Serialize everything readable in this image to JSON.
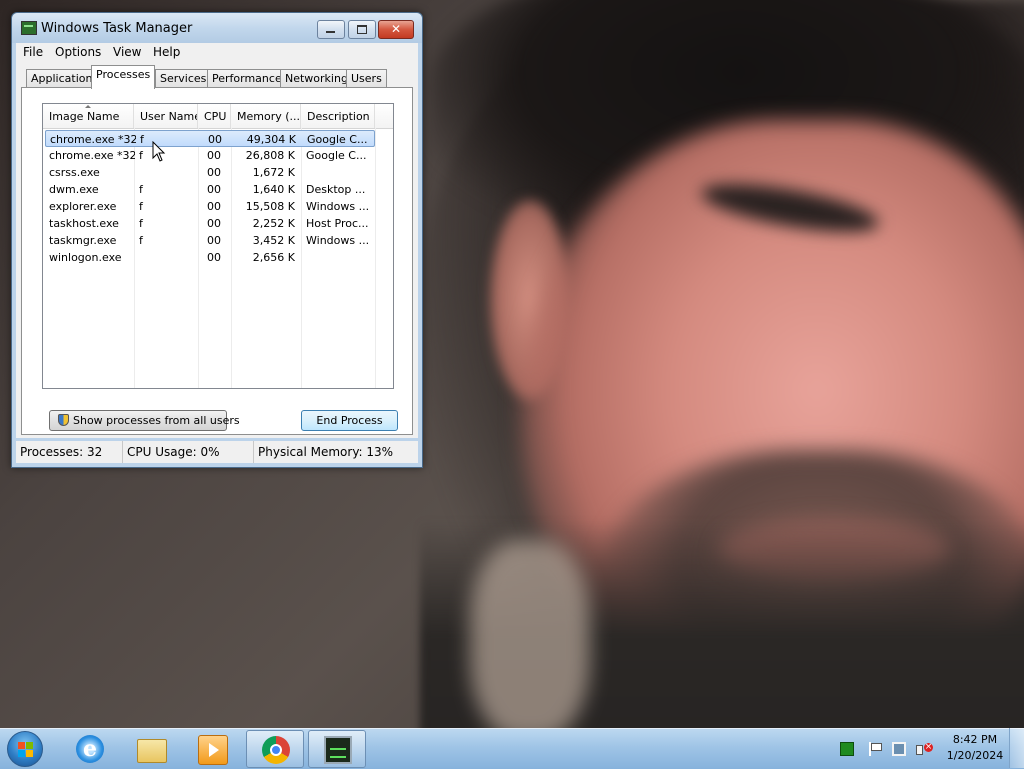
{
  "window": {
    "title": "Windows Task Manager",
    "close_glyph": "✕"
  },
  "menu": [
    "File",
    "Options",
    "View",
    "Help"
  ],
  "tabs": [
    "Applications",
    "Processes",
    "Services",
    "Performance",
    "Networking",
    "Users"
  ],
  "active_tab": "Processes",
  "columns": [
    "Image Name",
    "User Name",
    "CPU",
    "Memory (...",
    "Description"
  ],
  "processes": [
    {
      "name": "chrome.exe *32",
      "user": "f",
      "cpu": "00",
      "memory": "49,304 K",
      "description": "Google C...",
      "selected": true
    },
    {
      "name": "chrome.exe *32",
      "user": "f",
      "cpu": "00",
      "memory": "26,808 K",
      "description": "Google C..."
    },
    {
      "name": "csrss.exe",
      "user": "",
      "cpu": "00",
      "memory": "1,672 K",
      "description": ""
    },
    {
      "name": "dwm.exe",
      "user": "f",
      "cpu": "00",
      "memory": "1,640 K",
      "description": "Desktop ..."
    },
    {
      "name": "explorer.exe",
      "user": "f",
      "cpu": "00",
      "memory": "15,508 K",
      "description": "Windows ..."
    },
    {
      "name": "taskhost.exe",
      "user": "f",
      "cpu": "00",
      "memory": "2,252 K",
      "description": "Host Proc..."
    },
    {
      "name": "taskmgr.exe",
      "user": "f",
      "cpu": "00",
      "memory": "3,452 K",
      "description": "Windows ..."
    },
    {
      "name": "winlogon.exe",
      "user": "",
      "cpu": "00",
      "memory": "2,656 K",
      "description": ""
    }
  ],
  "buttons": {
    "show_all": "Show processes from all users",
    "end_process": "End Process"
  },
  "status": {
    "processes": "Processes: 32",
    "cpu": "CPU Usage: 0%",
    "memory": "Physical Memory: 13%"
  },
  "taskbar": {
    "pinned": [
      "internet-explorer",
      "windows-explorer",
      "media-player",
      "chrome",
      "task-manager"
    ],
    "active": "task-manager"
  },
  "clock": {
    "time": "8:42 PM",
    "date": "1/20/2024"
  },
  "colors": {
    "selection": "#c1dbfc",
    "close_button": "#c33a22",
    "taskbar": "#9fc4e6"
  }
}
